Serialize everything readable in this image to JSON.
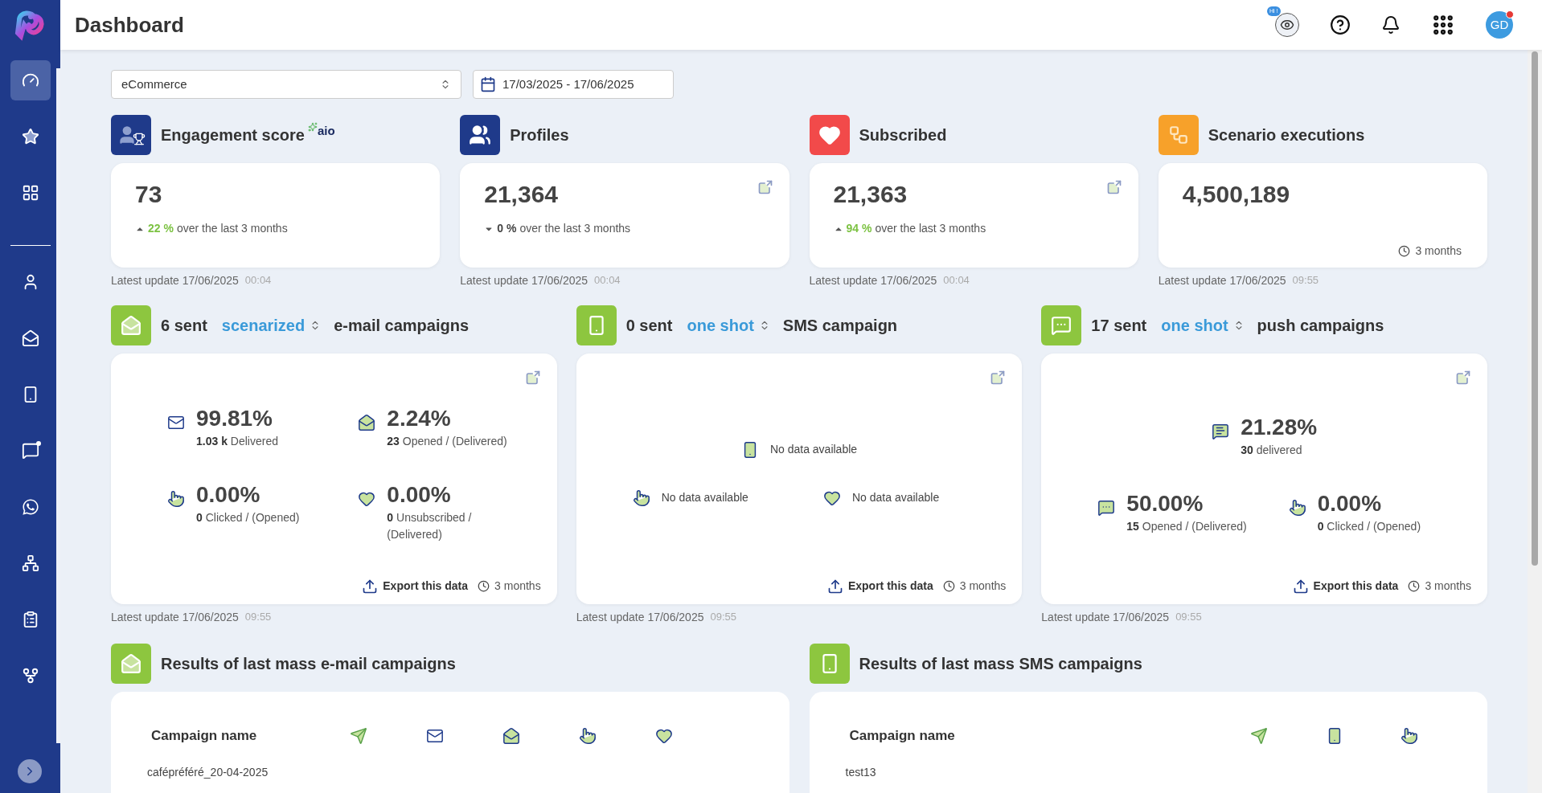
{
  "topbar": {
    "title": "Dashboard",
    "assistant_badge": "Hi !",
    "avatar": "GD",
    "avatar_alert": true
  },
  "sidebar": {
    "items": [
      {
        "kind": "dashboard",
        "selected": true
      },
      {
        "kind": "favorites",
        "selected": false
      },
      {
        "kind": "apps",
        "selected": false
      },
      {
        "kind": "divider"
      },
      {
        "kind": "contacts",
        "selected": false
      },
      {
        "kind": "email",
        "selected": false
      },
      {
        "kind": "sms",
        "selected": false
      },
      {
        "kind": "push",
        "selected": false
      },
      {
        "kind": "whatsapp",
        "selected": false
      },
      {
        "kind": "network",
        "selected": false
      },
      {
        "kind": "forms",
        "selected": false
      },
      {
        "kind": "hierarchy",
        "selected": false
      }
    ]
  },
  "filters": {
    "segment": "eCommerce",
    "date_range": "17/03/2025 - 17/06/2025"
  },
  "kpis": [
    {
      "kind": "engagement",
      "title": "Engagement score",
      "badge": "aio",
      "value": "73",
      "trend": {
        "kind": "up",
        "change": "22 %",
        "text": "over the last 3 months"
      },
      "external_link": false,
      "updated_date": "Latest update 17/06/2025",
      "updated_time": "00:04"
    },
    {
      "kind": "profiles",
      "title": "Profiles",
      "value": "21,364",
      "trend": {
        "kind": "down",
        "change": "0 %",
        "text": "over the last 3 months"
      },
      "external_link": true,
      "updated_date": "Latest update 17/06/2025",
      "updated_time": "00:04"
    },
    {
      "kind": "subscribed",
      "title": "Subscribed",
      "value": "21,363",
      "trend": {
        "kind": "up",
        "change": "94 %",
        "text": "over the last 3 months"
      },
      "external_link": true,
      "updated_date": "Latest update 17/06/2025",
      "updated_time": "00:04"
    },
    {
      "kind": "scenario",
      "title": "Scenario executions",
      "value": "4,500,189",
      "period": "3 months",
      "external_link": false,
      "updated_date": "Latest update 17/06/2025",
      "updated_time": "09:55"
    }
  ],
  "campaigns": [
    {
      "kind": "email",
      "count": "6 sent",
      "mode": "scenarized",
      "label": "e-mail campaigns",
      "rows": [
        [
          {
            "kind": "delivered",
            "value": "99.81%",
            "count": "1.03 k",
            "label": "Delivered"
          },
          {
            "kind": "opened",
            "value": "2.24%",
            "count": "23",
            "label": "Opened / (Delivered)"
          }
        ],
        [
          {
            "kind": "clicked",
            "value": "0.00%",
            "count": "0",
            "label": "Clicked / (Opened)"
          },
          {
            "kind": "unsubscribed",
            "value": "0.00%",
            "count": "0",
            "label": "Unsubscribed / (Delivered)"
          }
        ]
      ],
      "export": "Export this data",
      "period": "3 months",
      "updated_date": "Latest update 17/06/2025",
      "updated_time": "09:55"
    },
    {
      "kind": "sms",
      "count": "0 sent",
      "mode": "one shot",
      "label": "SMS campaign",
      "rows": [
        [
          {
            "kind": "mobile",
            "text": "No data available"
          }
        ],
        [
          {
            "kind": "clicked",
            "text": "No data available"
          },
          {
            "kind": "unsubscribed",
            "text": "No data available"
          }
        ]
      ],
      "export": "Export this data",
      "period": "3 months",
      "updated_date": "Latest update 17/06/2025",
      "updated_time": "09:55"
    },
    {
      "kind": "push",
      "count": "17 sent",
      "mode": "one shot",
      "label": "push campaigns",
      "rows": [
        [
          {
            "kind": "push_delivered",
            "value": "21.28%",
            "count": "30",
            "label": "delivered"
          }
        ],
        [
          {
            "kind": "push_opened",
            "value": "50.00%",
            "count": "15",
            "label": "Opened / (Delivered)"
          },
          {
            "kind": "clicked",
            "value": "0.00%",
            "count": "0",
            "label": "Clicked / (Opened)"
          }
        ]
      ],
      "export": "Export this data",
      "period": "3 months",
      "updated_date": "Latest update 17/06/2025",
      "updated_time": "09:55"
    }
  ],
  "results": [
    {
      "kind": "email",
      "title": "Results of last mass e-mail campaigns",
      "columns": [
        {
          "kind": "name",
          "label": "Campaign name"
        },
        {
          "kind": "sent"
        },
        {
          "kind": "delivered"
        },
        {
          "kind": "opened"
        },
        {
          "kind": "clicked"
        },
        {
          "kind": "unsubscribed"
        }
      ],
      "rows": [
        {
          "name": "cafépréféré_20-04-2025"
        }
      ]
    },
    {
      "kind": "sms",
      "title": "Results of last mass SMS campaigns",
      "columns": [
        {
          "kind": "name",
          "label": "Campaign name"
        },
        {
          "kind": "sent"
        },
        {
          "kind": "mobile"
        },
        {
          "kind": "clicked"
        }
      ],
      "rows": [
        {
          "name": "test13"
        }
      ]
    }
  ]
}
